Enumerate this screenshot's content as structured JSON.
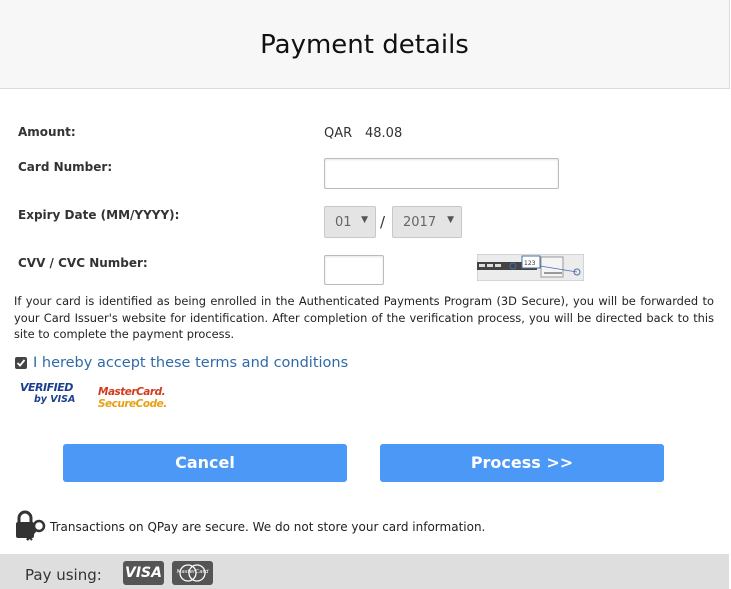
{
  "title": "Payment details",
  "amount": {
    "label": "Amount:",
    "currency": "QAR",
    "value": "48.08"
  },
  "card_number": {
    "label": "Card Number:",
    "value": ""
  },
  "expiry": {
    "label": "Expiry Date (MM/YYYY):",
    "month": "01",
    "separator": "/",
    "year": "2017"
  },
  "cvv": {
    "label": "CVV / CVC Number:",
    "value": "",
    "hint_digits": "123"
  },
  "notice": "If your card is identified as being enrolled in the Authenticated Payments Program (3D Secure), you will be forwarded to your Card Issuer's website for identification. After completion of the verification process, you will be directed back to this site to complete the payment process.",
  "terms": {
    "label": "I hereby accept these terms and conditions",
    "checked": true
  },
  "logos": {
    "verified_line1": "VERIFIED",
    "verified_line2": "by VISA",
    "mc_line1": "MasterCard.",
    "mc_line2": "SecureCode."
  },
  "buttons": {
    "cancel": "Cancel",
    "process": "Process >>"
  },
  "secure_note": "Transactions on QPay are secure. We do not store your card information.",
  "footer": {
    "pay_using": "Pay using:",
    "visa": "VISA",
    "mastercard": "MasterCard"
  }
}
